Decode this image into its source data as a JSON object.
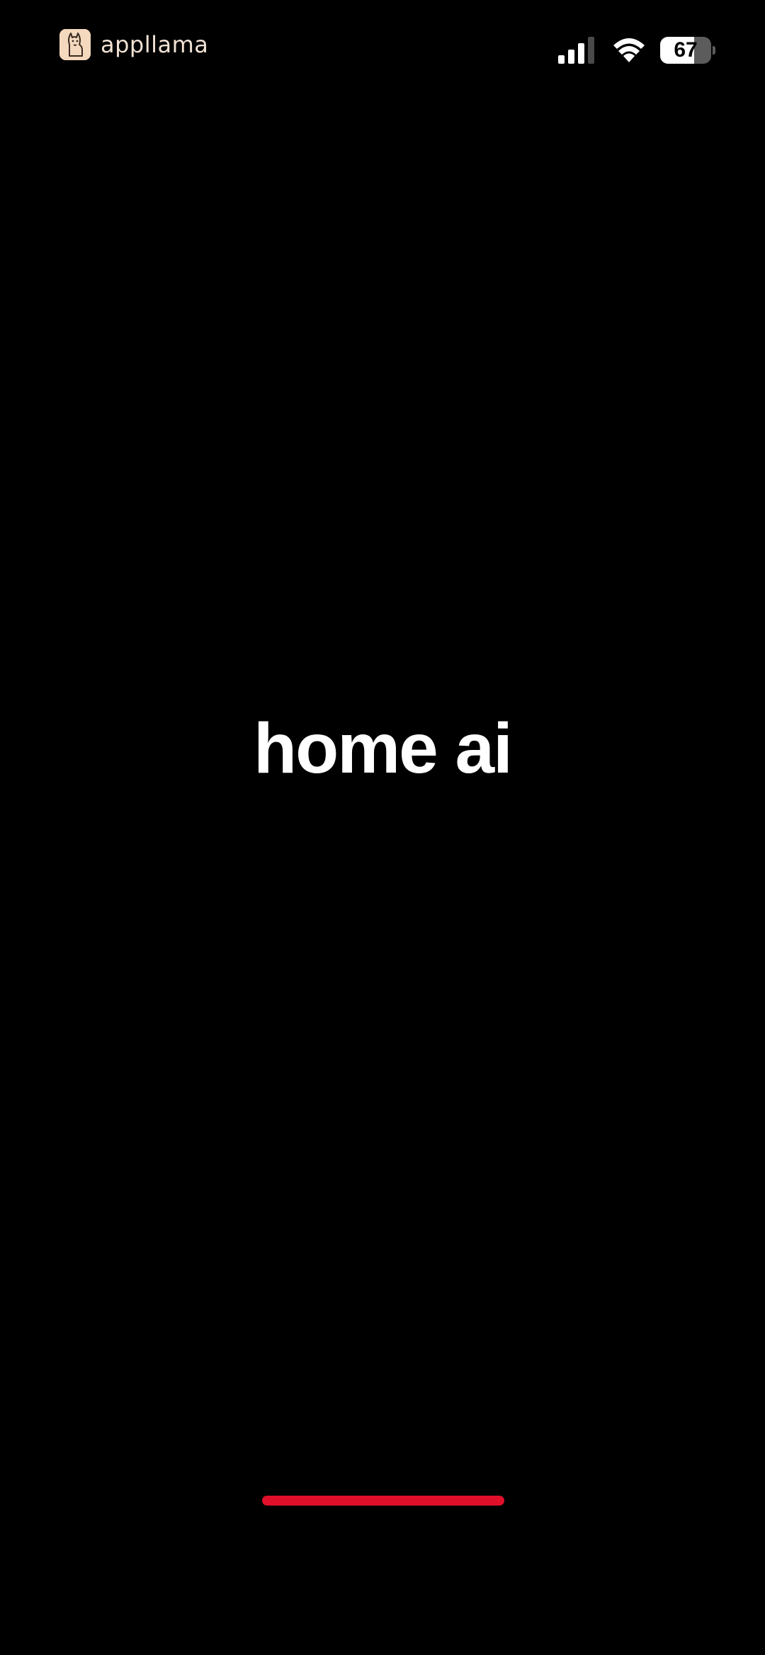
{
  "status_bar": {
    "brand_name": "appllama",
    "brand_icon": "llama-icon",
    "signal_icon": "cellular-signal-icon",
    "wifi_icon": "wifi-icon",
    "battery_level": "67",
    "battery_fraction": 0.67
  },
  "main": {
    "title": "home ai"
  },
  "colors": {
    "background": "#000000",
    "title": "#ffffff",
    "accent": "#e0102a"
  }
}
